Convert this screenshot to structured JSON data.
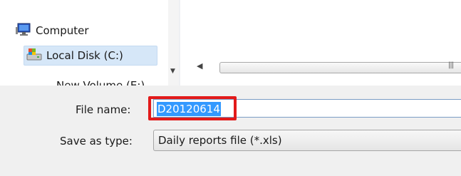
{
  "nav_pane": {
    "items": [
      {
        "label": "Computer",
        "icon": "computer-icon"
      },
      {
        "label": "Local Disk (C:)",
        "icon": "local-disk-icon"
      },
      {
        "label": "New Volume (E:)",
        "icon": "drive-icon"
      }
    ]
  },
  "save_panel": {
    "file_name_label": "File name:",
    "file_name_value": "D20120614",
    "save_as_type_label": "Save as type:",
    "save_as_type_value": "Daily reports file (*.xls)"
  },
  "colors": {
    "highlight_border": "#e21a1a",
    "selection": "#3399ff"
  }
}
